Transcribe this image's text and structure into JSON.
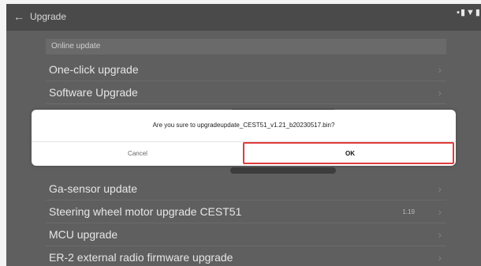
{
  "topbar": {
    "title": "Upgrade",
    "back_icon": "arrow-left-icon",
    "status_icons": "▪▮▼▮"
  },
  "list": {
    "section_label": "Online update",
    "items": [
      {
        "label": "One-click upgrade",
        "value": ""
      },
      {
        "label": "Software Upgrade",
        "value": ""
      },
      {
        "label": "Ga-sensor update",
        "value": ""
      },
      {
        "label": "Steering wheel motor upgrade CEST51",
        "value": "1.19"
      },
      {
        "label": "MCU upgrade",
        "value": ""
      },
      {
        "label": "ER-2 external radio firmware upgrade",
        "value": ""
      }
    ],
    "chevron": "›"
  },
  "dialog": {
    "message": "Are you sure to upgradeupdate_CEST51_v1.21_b20230517.bin?",
    "cancel_label": "Cancel",
    "ok_label": "OK"
  },
  "colors": {
    "highlight": "#e03b3b",
    "screen_bg": "#5f5f5f",
    "dialog_bg": "#ffffff"
  }
}
